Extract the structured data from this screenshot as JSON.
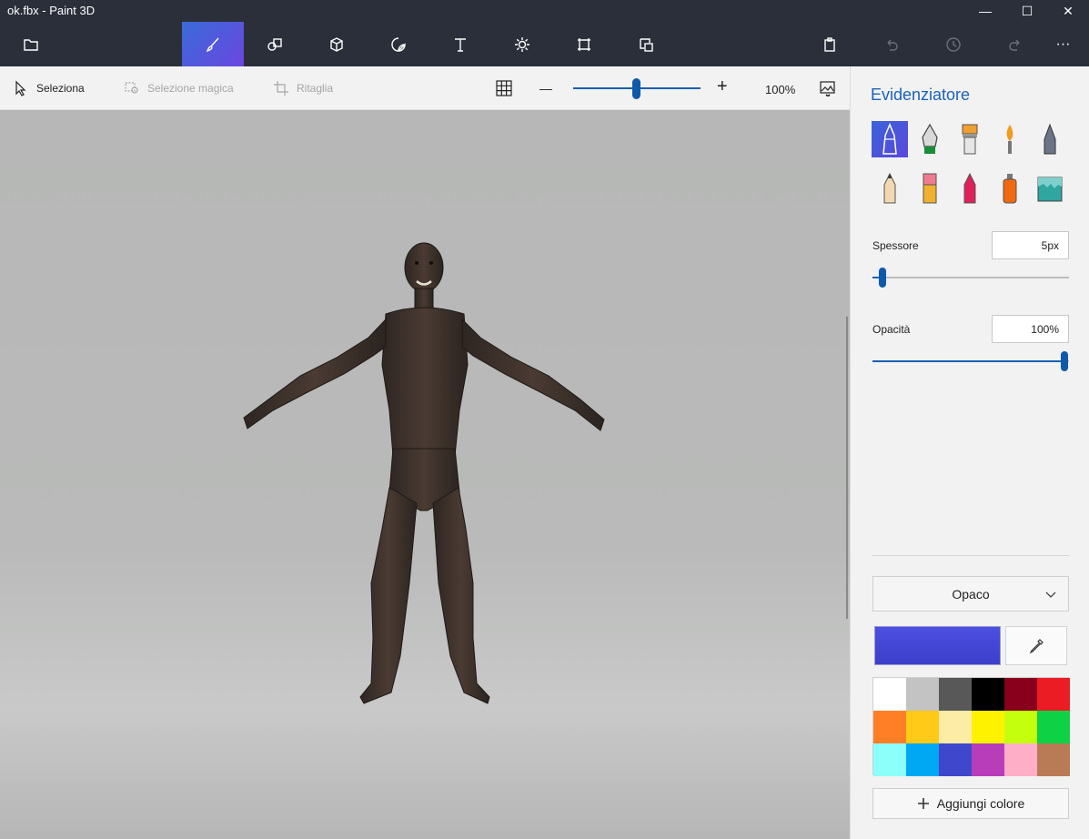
{
  "window": {
    "title": "ok.fbx - Paint 3D"
  },
  "window_controls": {
    "minimize": "—",
    "maximize": "☐",
    "close": "✕"
  },
  "toolbar": {
    "tools": [
      {
        "name": "menu-icon"
      },
      {
        "name": "brushes-icon",
        "active": true
      },
      {
        "name": "2d-shapes-icon"
      },
      {
        "name": "3d-shapes-icon"
      },
      {
        "name": "stickers-icon"
      },
      {
        "name": "text-icon"
      },
      {
        "name": "effects-icon"
      },
      {
        "name": "canvas-icon"
      },
      {
        "name": "3d-library-icon"
      }
    ],
    "more": "···"
  },
  "subbar": {
    "select_label": "Seleziona",
    "magic_select_label": "Selezione magica",
    "crop_label": "Ritaglia",
    "zoom_minus": "—",
    "zoom_plus": "+",
    "zoom_value": "100%",
    "zoom_level_fraction": 0.5
  },
  "panel": {
    "title": "Evidenziatore",
    "brushes": [
      "marker",
      "calligraphy-pen",
      "oil-brush",
      "watercolor",
      "pixel-pen",
      "pencil",
      "eraser",
      "crayon",
      "spray-can",
      "fill"
    ],
    "thickness_label": "Spessore",
    "thickness_value": "5px",
    "thickness_fraction": 0.05,
    "opacity_label": "Opacità",
    "opacity_value": "100%",
    "opacity_fraction": 1.0,
    "finish_value": "Opaco",
    "current_color": "#3b3fc9",
    "palette": [
      "#ffffff",
      "#c3c3c3",
      "#585858",
      "#000000",
      "#88001b",
      "#ec1c24",
      "#ff7f27",
      "#ffca18",
      "#fdeca6",
      "#fff200",
      "#c4ff0e",
      "#0ed145",
      "#8cfffb",
      "#00a8f3",
      "#3f48cc",
      "#b83dba",
      "#ffaec8",
      "#b97a56"
    ],
    "add_color_label": "Aggiungi colore"
  }
}
